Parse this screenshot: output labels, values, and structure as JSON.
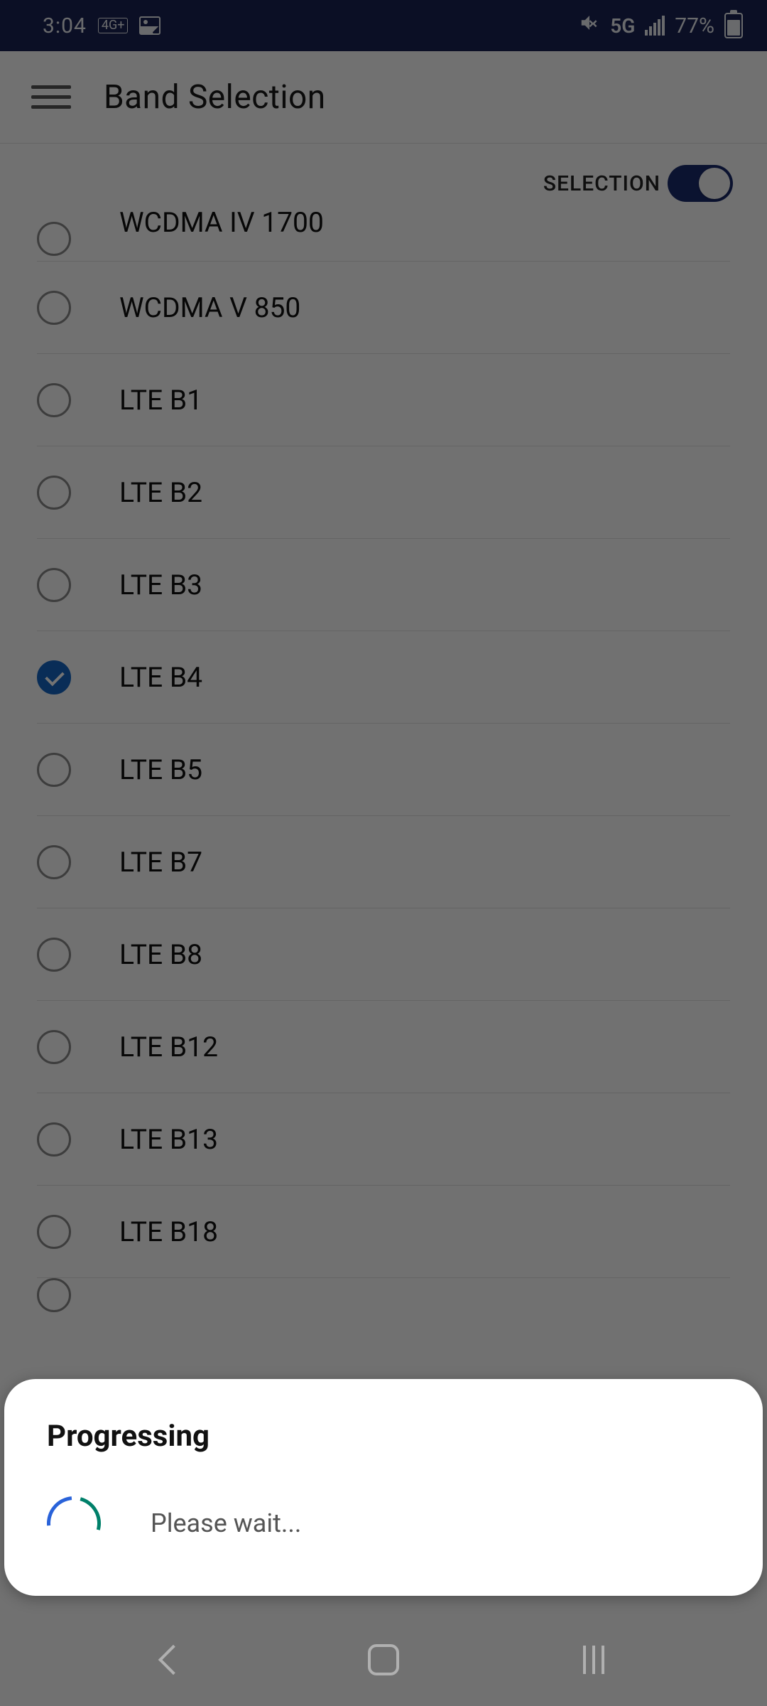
{
  "status_bar": {
    "time": "3:04",
    "indicator_4g": "4G+",
    "network_label": "5G",
    "battery_pct": "77%"
  },
  "header": {
    "title": "Band Selection"
  },
  "selection_toggle": {
    "label": "SELECTION",
    "on": true
  },
  "bands": [
    {
      "label": "WCDMA IV 1700",
      "checked": false,
      "clipped": "top"
    },
    {
      "label": "WCDMA V 850",
      "checked": false
    },
    {
      "label": "LTE B1",
      "checked": false
    },
    {
      "label": "LTE B2",
      "checked": false
    },
    {
      "label": "LTE B3",
      "checked": false
    },
    {
      "label": "LTE B4",
      "checked": true
    },
    {
      "label": "LTE B5",
      "checked": false
    },
    {
      "label": "LTE B7",
      "checked": false
    },
    {
      "label": "LTE B8",
      "checked": false
    },
    {
      "label": "LTE B12",
      "checked": false
    },
    {
      "label": "LTE B13",
      "checked": false
    },
    {
      "label": "LTE B18",
      "checked": false
    },
    {
      "label": "",
      "checked": false,
      "clipped": "bottom"
    }
  ],
  "dialog": {
    "title": "Progressing",
    "message": "Please wait..."
  }
}
